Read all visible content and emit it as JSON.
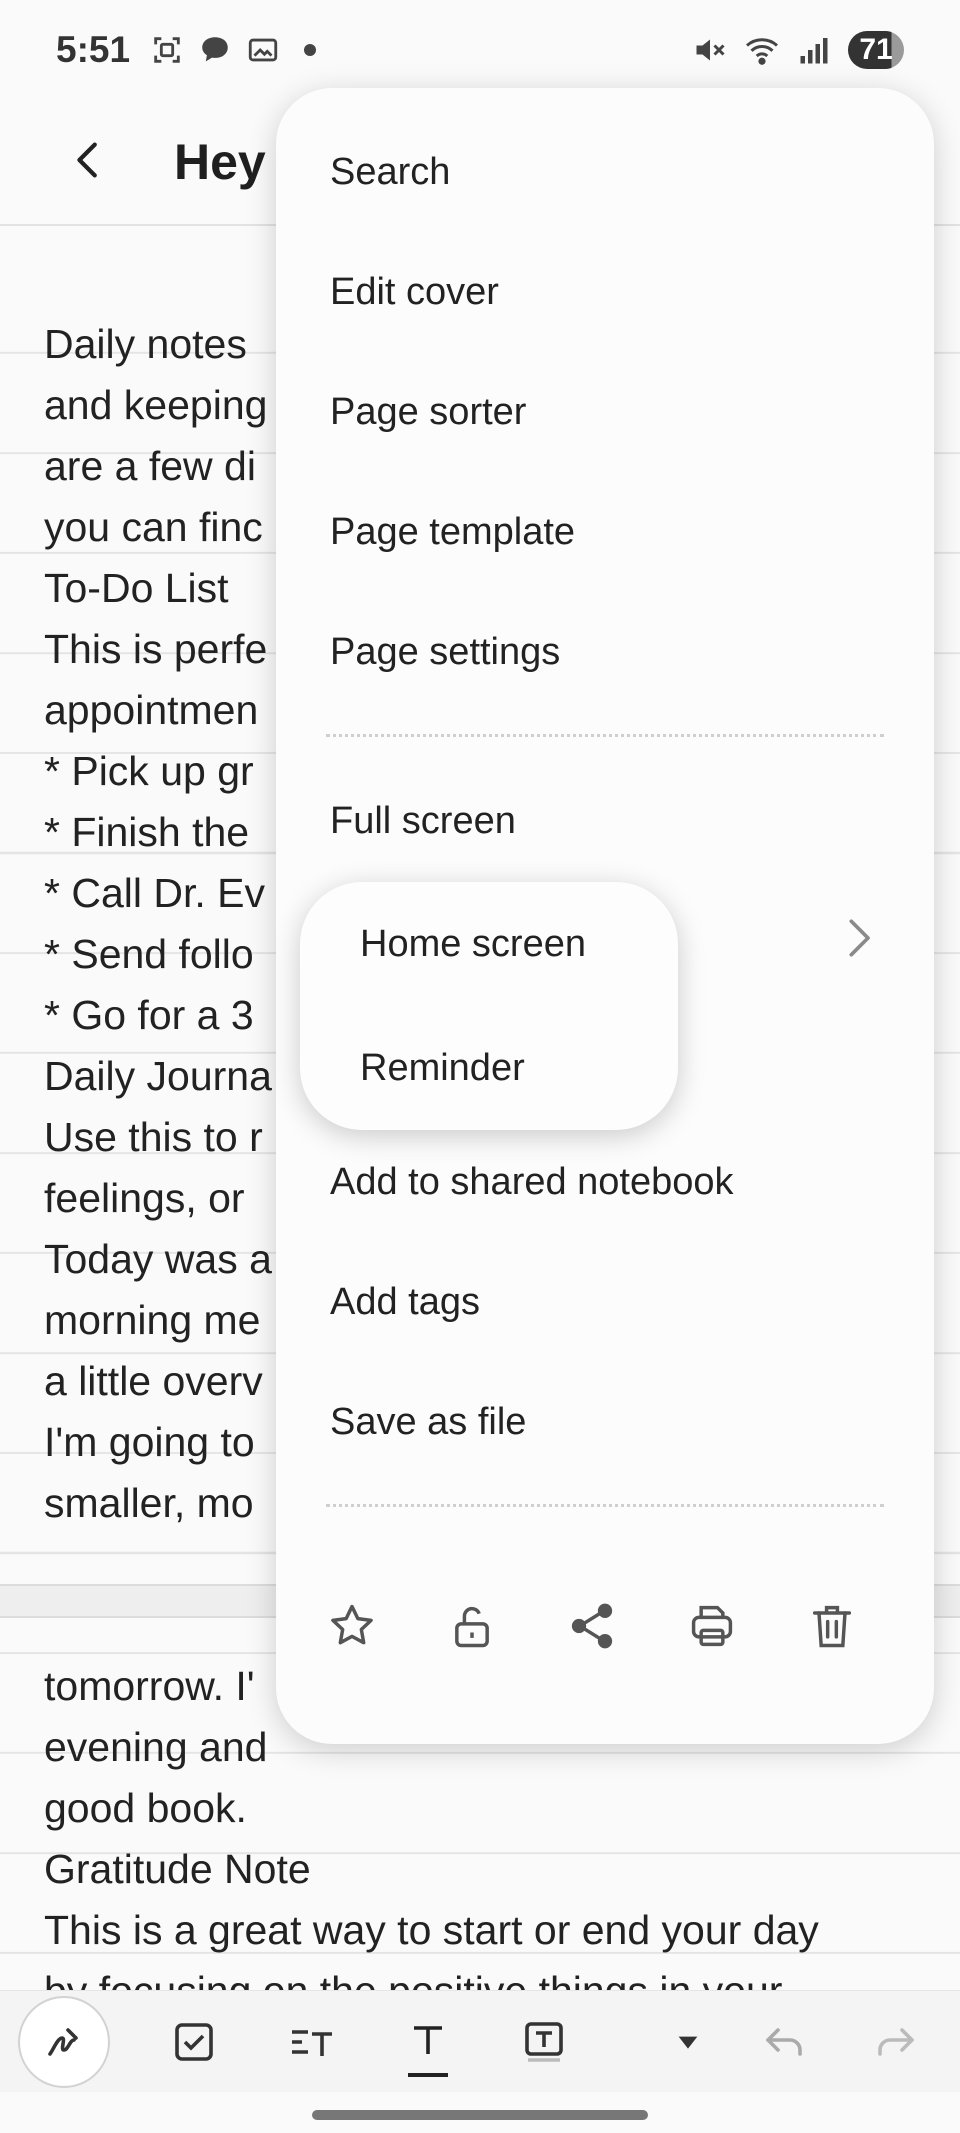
{
  "status_bar": {
    "time": "5:51",
    "battery": "71",
    "notification_icons": [
      "screenshot-icon",
      "chat-icon",
      "photo-icon"
    ],
    "system_icons": [
      "mute-icon",
      "wifi-icon",
      "signal-icon"
    ]
  },
  "header": {
    "title": "Hey t"
  },
  "note": {
    "lines": [
      "Daily notes",
      "and keeping",
      "are a few di",
      "you can finc",
      "To-Do List",
      "This is perfe",
      "appointmen",
      " * Pick up gr",
      " * Finish the",
      " * Call Dr. Ev",
      " * Send follo",
      " * Go for a 3",
      "Daily Journa",
      "Use this to r",
      "feelings, or",
      "Today was a",
      "morning me",
      "a little overv",
      "I'm going to",
      "smaller, mo",
      "",
      "",
      "tomorrow. I'",
      "evening and",
      "good book.",
      "Gratitude Note",
      "This is a great way to start or end your day",
      "by focusing on the positive things in your"
    ]
  },
  "menu": {
    "items": [
      "Search",
      "Edit cover",
      "Page sorter",
      "Page template",
      "Page settings",
      "Full screen",
      "Add to shared notebook",
      "Add tags",
      "Save as file"
    ],
    "actions": [
      "star-icon",
      "lock-open-icon",
      "share-icon",
      "print-icon",
      "trash-icon"
    ]
  },
  "submenu": {
    "items": [
      "Home screen",
      "Reminder"
    ]
  },
  "toolbar": {
    "tools": [
      "pen-icon",
      "checkbox-icon",
      "text-format-icon",
      "text-icon",
      "text-box-icon",
      "dropdown-icon",
      "undo-icon",
      "redo-icon"
    ]
  }
}
